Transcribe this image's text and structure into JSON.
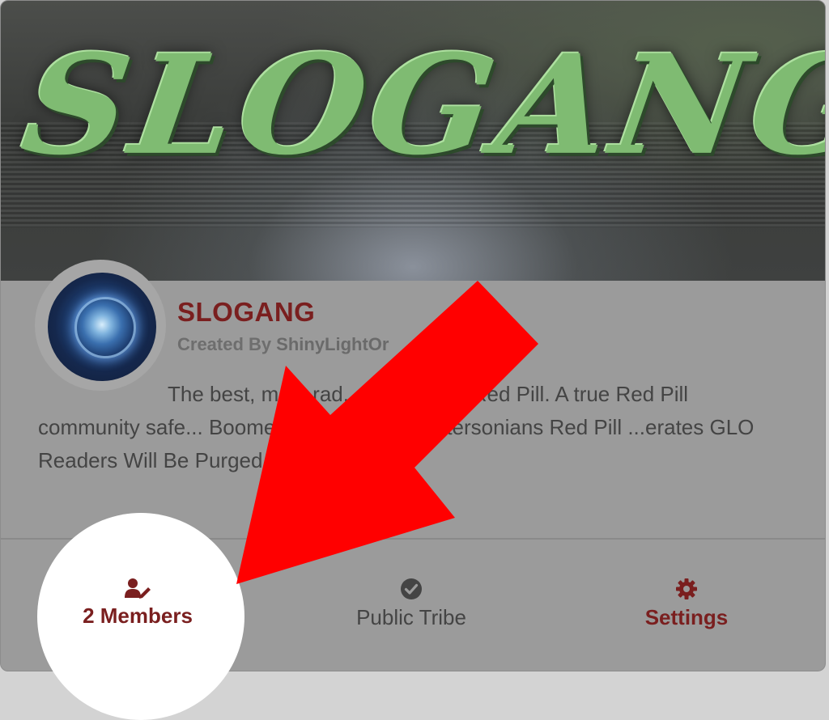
{
  "banner": {
    "logo_text": "SLOGANG"
  },
  "tribe": {
    "name": "SLOGANG",
    "created_by_label": "Created By",
    "creator": "ShinyLightOr",
    "description": "The best, most rad... tribe of the Red Pill. A true Red Pill community safe... Boomers, non-pareils, Petersonians Red Pill ...erates GLO Readers Will Be Purged"
  },
  "footer": {
    "members_label": "2 Members",
    "members_icon": "user-edit-icon",
    "public_label": "Public Tribe",
    "public_icon": "check-circle-icon",
    "settings_label": "Settings",
    "settings_icon": "gear-icon"
  },
  "colors": {
    "accent": "#7a1f1f",
    "arrow": "#ff0000",
    "logo_green": "#7fbb72"
  }
}
